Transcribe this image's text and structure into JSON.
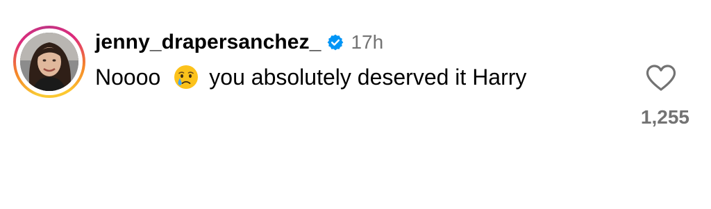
{
  "comment": {
    "username": "jenny_drapersanchez_",
    "verified": true,
    "timestamp": "17h",
    "text_before_emoji": "Noooo",
    "emoji": "crying-face",
    "text_after_emoji": "you absolutely deserved it Harry"
  },
  "like": {
    "icon": "heart-outline-icon",
    "count": "1,255"
  },
  "colors": {
    "verified_blue": "#0095f6",
    "secondary_text": "#737373",
    "story_ring": [
      "#f9c934",
      "#f58529",
      "#dd2a7b",
      "#c13584"
    ]
  }
}
